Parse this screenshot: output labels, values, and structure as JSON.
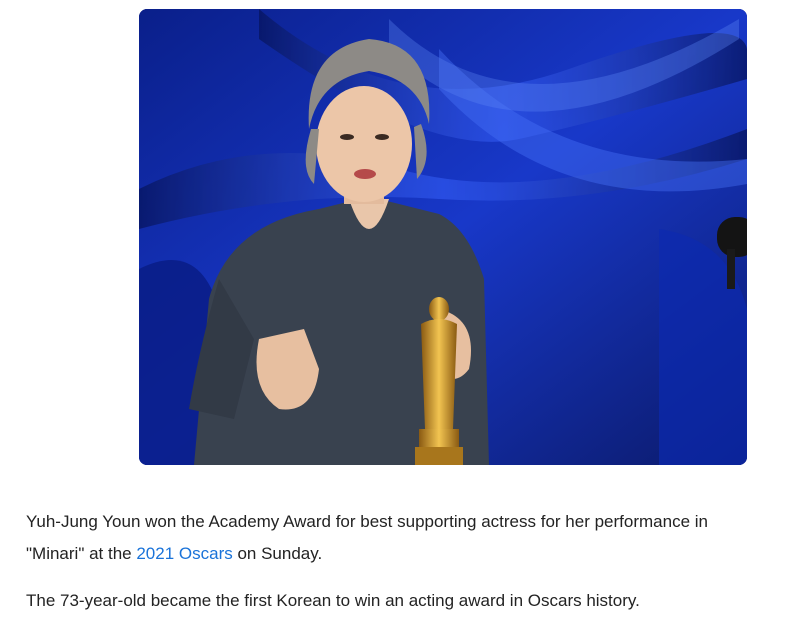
{
  "article": {
    "image": {
      "alt_icon": "photo-oscar-winner",
      "colors": {
        "curtain": "#1436c8",
        "dress": "#3a4452",
        "statuette": "#d9a632"
      }
    },
    "paragraph1": {
      "before": "Yuh-Jung Youn won the Academy Award for best supporting actress for her performance in \"Minari\" at the ",
      "link": "2021 Oscars",
      "after": " on Sunday."
    },
    "paragraph2": "The 73-year-old became the first Korean to win an acting award in Oscars history.",
    "link_color": "#1a73d9"
  }
}
